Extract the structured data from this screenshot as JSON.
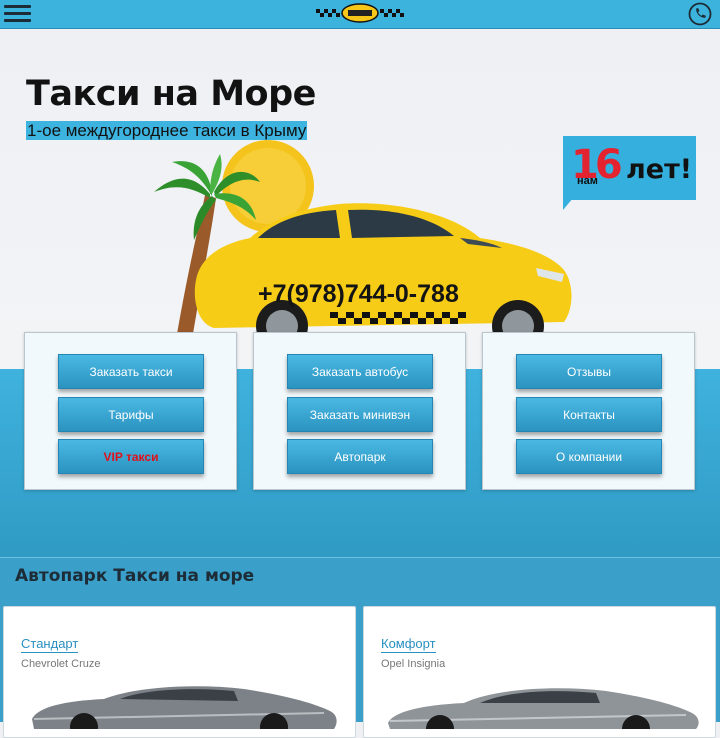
{
  "header": {
    "menu_icon": "hamburger-menu-icon",
    "logo_icon": "taxi-checker-logo",
    "phone_icon": "phone-icon"
  },
  "hero": {
    "title": "Такси на Море",
    "subtitle": "1-ое междугороднее такси в Крыму",
    "car_phone": "+7(978)744-0-788",
    "badge": {
      "number": "16",
      "small": "нам",
      "text": "лет!"
    }
  },
  "menus": [
    {
      "buttons": [
        "Заказать такси",
        "Тарифы",
        "VIP такси"
      ]
    },
    {
      "buttons": [
        "Заказать автобус",
        "Заказать минивэн",
        "Автопарк"
      ]
    },
    {
      "buttons": [
        "Отзывы",
        "Контакты",
        "О компании"
      ]
    }
  ],
  "fleet": {
    "title": "Автопарк Такси на море",
    "cards": [
      {
        "name": "Стандарт",
        "model": "Chevrolet Cruze"
      },
      {
        "name": "Комфорт",
        "model": "Opel Insignia"
      }
    ]
  },
  "colors": {
    "accent": "#3cb3dc",
    "vip": "#e0101a",
    "taxi_yellow": "#f7cc17"
  }
}
